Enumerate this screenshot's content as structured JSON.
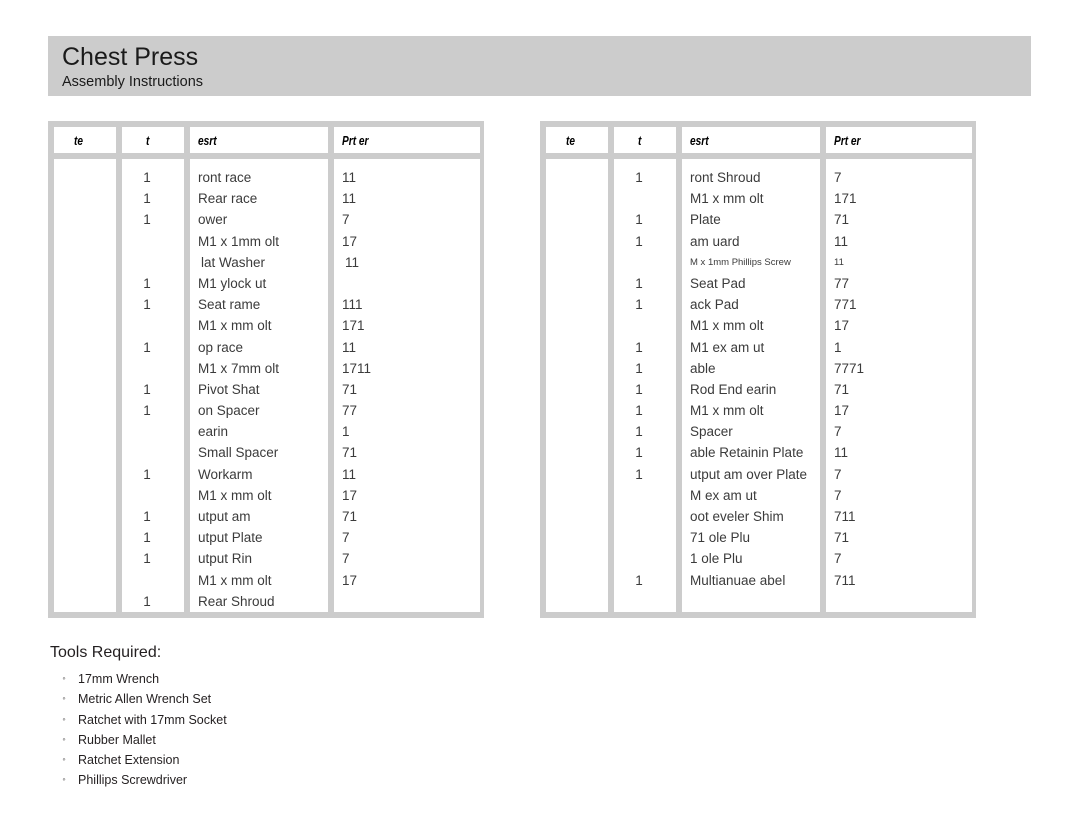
{
  "document": {
    "title": "Chest Press",
    "subtitle": "Assembly Instructions"
  },
  "tables": {
    "columns": [
      {
        "key": "item",
        "header": "te"
      },
      {
        "key": "qty",
        "header": "t"
      },
      {
        "key": "desc",
        "header": "esrt"
      },
      {
        "key": "part",
        "header": "Prt er"
      }
    ],
    "left": {
      "rows": [
        {
          "item": "",
          "qty": "1",
          "desc": "ront race",
          "part": "11",
          "style": ""
        },
        {
          "item": "",
          "qty": "1",
          "desc": "Rear race",
          "part": "11",
          "style": ""
        },
        {
          "item": "",
          "qty": "1",
          "desc": "ower",
          "part": "7",
          "style": ""
        },
        {
          "item": "",
          "qty": "",
          "desc": "M1 x 1mm olt",
          "part": "17",
          "style": ""
        },
        {
          "item": "",
          "qty": "",
          "desc": "lat Washer",
          "part": "11",
          "style": "indent"
        },
        {
          "item": "",
          "qty": "1",
          "desc": "M1 ylock ut",
          "part": "",
          "style": ""
        },
        {
          "item": "",
          "qty": "1",
          "desc": "Seat rame",
          "part": "111",
          "style": ""
        },
        {
          "item": "",
          "qty": "",
          "desc": "M1 x mm olt",
          "part": "171",
          "style": ""
        },
        {
          "item": "",
          "qty": "1",
          "desc": "op race",
          "part": "11",
          "style": ""
        },
        {
          "item": "",
          "qty": "",
          "desc": "M1 x 7mm olt",
          "part": "1711",
          "style": ""
        },
        {
          "item": "",
          "qty": "1",
          "desc": "Pivot Shat",
          "part": "71",
          "style": ""
        },
        {
          "item": "",
          "qty": "1",
          "desc": "on Spacer",
          "part": "77",
          "style": ""
        },
        {
          "item": "",
          "qty": "",
          "desc": "earin",
          "part": "1",
          "style": ""
        },
        {
          "item": "",
          "qty": "",
          "desc": "Small Spacer",
          "part": "71",
          "style": ""
        },
        {
          "item": "",
          "qty": "1",
          "desc": "Workarm",
          "part": "11",
          "style": ""
        },
        {
          "item": "",
          "qty": "",
          "desc": "M1 x mm olt",
          "part": "17",
          "style": ""
        },
        {
          "item": "",
          "qty": "1",
          "desc": "utput am",
          "part": "71",
          "style": ""
        },
        {
          "item": "",
          "qty": "1",
          "desc": "utput Plate",
          "part": "7",
          "style": ""
        },
        {
          "item": "",
          "qty": "1",
          "desc": "utput Rin",
          "part": "7",
          "style": ""
        },
        {
          "item": "",
          "qty": "",
          "desc": "M1 x mm olt",
          "part": "17",
          "style": ""
        },
        {
          "item": "",
          "qty": "1",
          "desc": "Rear Shroud",
          "part": "",
          "style": ""
        }
      ]
    },
    "right": {
      "rows": [
        {
          "item": "",
          "qty": "1",
          "desc": "ront Shroud",
          "part": "7",
          "style": ""
        },
        {
          "item": "",
          "qty": "",
          "desc": "M1 x mm olt",
          "part": "171",
          "style": ""
        },
        {
          "item": "",
          "qty": "1",
          "desc": "Plate",
          "part": "71",
          "style": ""
        },
        {
          "item": "",
          "qty": "1",
          "desc": "am uard",
          "part": "11",
          "style": ""
        },
        {
          "item": "",
          "qty": "",
          "desc": "M x 1mm Phillips Screw",
          "part": "11",
          "style": "shrunk"
        },
        {
          "item": "",
          "qty": "1",
          "desc": "Seat Pad",
          "part": "77",
          "style": ""
        },
        {
          "item": "",
          "qty": "1",
          "desc": "ack Pad",
          "part": "771",
          "style": ""
        },
        {
          "item": "",
          "qty": "",
          "desc": "M1 x mm olt",
          "part": "17",
          "style": ""
        },
        {
          "item": "",
          "qty": "1",
          "desc": "M1 ex am ut",
          "part": "1",
          "style": ""
        },
        {
          "item": "",
          "qty": "1",
          "desc": "able",
          "part": "7771",
          "style": ""
        },
        {
          "item": "",
          "qty": "1",
          "desc": "Rod End earin",
          "part": "71",
          "style": ""
        },
        {
          "item": "",
          "qty": "1",
          "desc": "M1 x mm olt",
          "part": "17",
          "style": ""
        },
        {
          "item": "",
          "qty": "1",
          "desc": "Spacer",
          "part": "7",
          "style": ""
        },
        {
          "item": "",
          "qty": "1",
          "desc": "able Retainin Plate",
          "part": "11",
          "style": ""
        },
        {
          "item": "",
          "qty": "1",
          "desc": "utput am over Plate",
          "part": "7",
          "style": ""
        },
        {
          "item": "",
          "qty": "",
          "desc": "M ex am ut",
          "part": "7",
          "style": ""
        },
        {
          "item": "",
          "qty": "",
          "desc": "oot eveler Shim",
          "part": "711",
          "style": ""
        },
        {
          "item": "",
          "qty": "",
          "desc": "71 ole Plu",
          "part": "71",
          "style": ""
        },
        {
          "item": "",
          "qty": "",
          "desc": "1 ole Plu",
          "part": "7",
          "style": ""
        },
        {
          "item": "",
          "qty": "1",
          "desc": "Multianuae abel",
          "part": "711",
          "style": ""
        }
      ]
    }
  },
  "tools": {
    "heading": "Tools Required:",
    "bullet": "◦",
    "items": [
      "17mm Wrench",
      "Metric Allen Wrench Set",
      "Ratchet with 17mm Socket",
      "Rubber Mallet",
      "Ratchet Extension",
      "Phillips Screwdriver"
    ]
  },
  "colors": {
    "banner": "#cccccc",
    "table_frame": "#cccccc",
    "cell": "#ffffff",
    "text": "#231f20",
    "body_text": "#3b3b3b"
  }
}
